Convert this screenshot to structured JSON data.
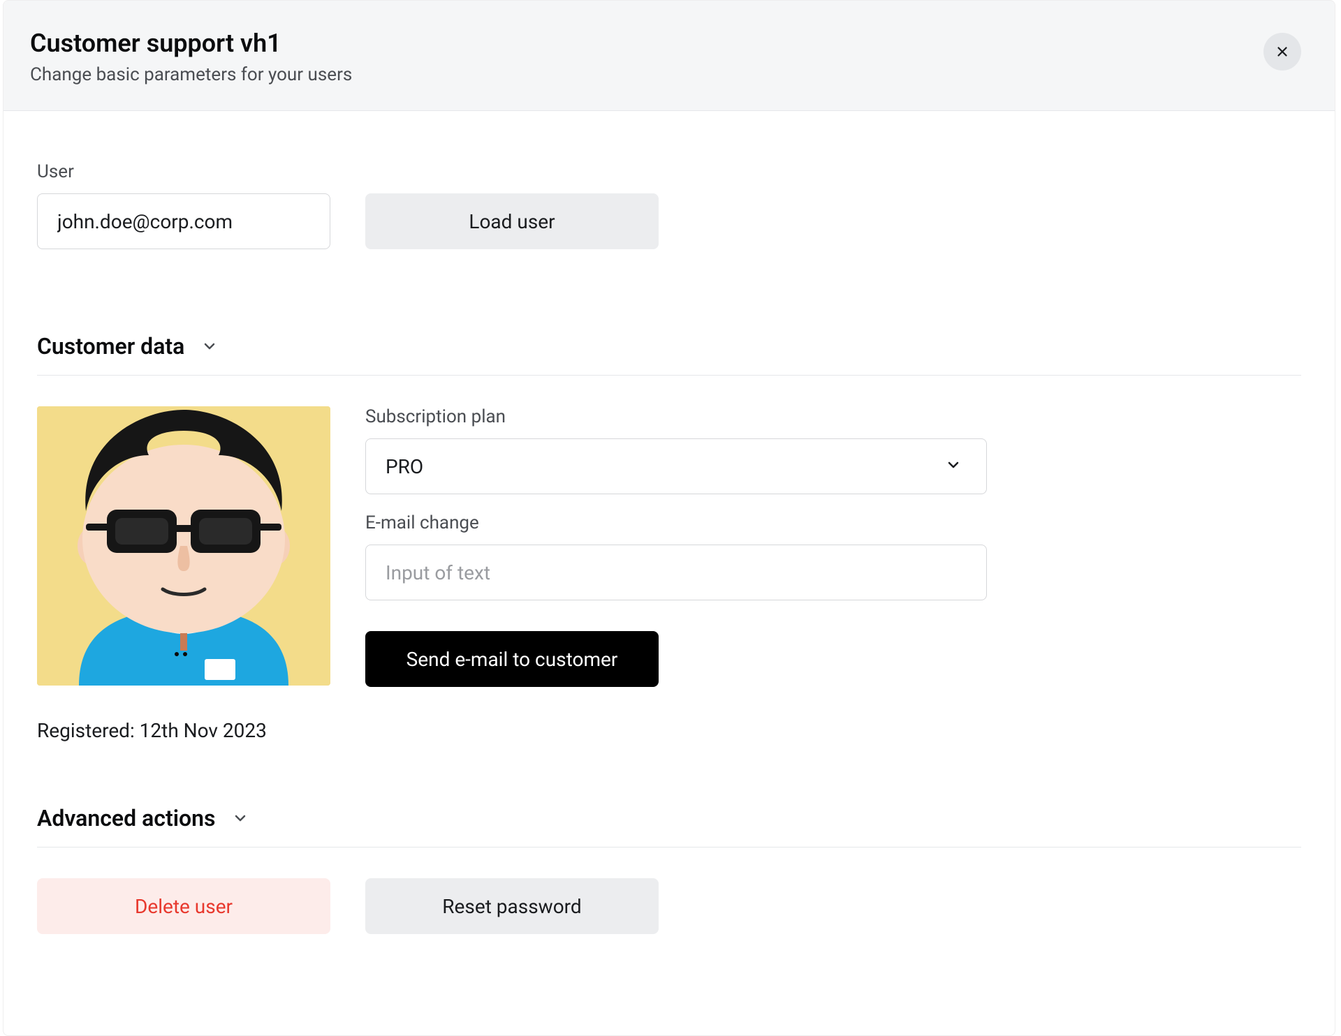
{
  "header": {
    "title": "Customer support vh1",
    "subtitle": "Change basic parameters for your users"
  },
  "user_lookup": {
    "label": "User",
    "value": "john.doe@corp.com",
    "load_button": "Load user"
  },
  "customer_data": {
    "section_title": "Customer data",
    "registered": "Registered: 12th Nov 2023",
    "subscription": {
      "label": "Subscription plan",
      "value": "PRO"
    },
    "email_change": {
      "label": "E-mail change",
      "placeholder": "Input of text"
    },
    "send_email_button": "Send e-mail to customer"
  },
  "advanced": {
    "section_title": "Advanced actions",
    "delete_button": "Delete user",
    "reset_button": "Reset password"
  }
}
